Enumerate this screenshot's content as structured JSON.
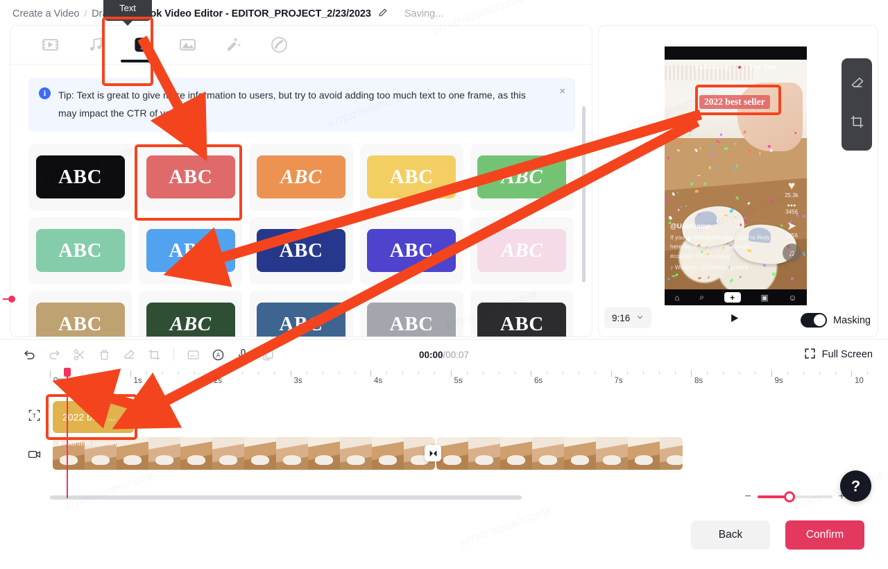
{
  "breadcrumb": {
    "root": "Create a Video",
    "sep": "/",
    "drafts": "Drafts",
    "current": "TikTok Video Editor - EDITOR_PROJECT_2/23/2023",
    "edit_icon": "pencil-icon",
    "status": "Saving..."
  },
  "toolbar": {
    "tabs": [
      {
        "name": "video",
        "icon": "film-icon",
        "active": false
      },
      {
        "name": "music",
        "icon": "music-note-icon",
        "active": false
      },
      {
        "name": "text",
        "icon": "text-t-icon",
        "active": true
      },
      {
        "name": "transition",
        "icon": "transition-icon",
        "active": false
      },
      {
        "name": "effects",
        "icon": "magic-wand-icon",
        "active": false
      },
      {
        "name": "sticker",
        "icon": "sticker-icon",
        "active": false
      }
    ],
    "tooltip": "Text"
  },
  "tip": {
    "icon": "info-icon",
    "text": "Tip: Text is great to give more information to users, but try to avoid adding too much text to one frame, as this may impact the CTR of your ad.",
    "close": "×"
  },
  "styles": {
    "label": "ABC",
    "items": [
      {
        "bg": "#0d0d0f",
        "fg": "#ffffff",
        "italic": false,
        "selected": false
      },
      {
        "bg": "#e06a6a",
        "fg": "#ffffff",
        "italic": false,
        "selected": true
      },
      {
        "bg": "#ec9352",
        "fg": "#ffffff",
        "italic": true,
        "selected": false
      },
      {
        "bg": "#f3cf63",
        "fg": "#ffffff",
        "italic": false,
        "selected": false
      },
      {
        "bg": "#74c374",
        "fg": "#ffffff",
        "italic": true,
        "selected": false
      },
      {
        "bg": "#85ccaa",
        "fg": "#ffffff",
        "italic": false,
        "selected": false
      },
      {
        "bg": "#52a3ef",
        "fg": "#ffffff",
        "italic": false,
        "selected": false
      },
      {
        "bg": "#26388b",
        "fg": "#ffffff",
        "italic": false,
        "selected": false
      },
      {
        "bg": "#4d43cc",
        "fg": "#ffffff",
        "italic": false,
        "selected": false
      },
      {
        "bg": "#f5dbe8",
        "fg": "#ffffff",
        "italic": true,
        "selected": false
      },
      {
        "bg": "#bfa271",
        "fg": "#ffffff",
        "italic": false,
        "selected": false
      },
      {
        "bg": "#2f4f34",
        "fg": "#ffffff",
        "italic": true,
        "selected": false
      },
      {
        "bg": "#3e6590",
        "fg": "#ffffff",
        "italic": false,
        "selected": false
      },
      {
        "bg": "#a3a7ad",
        "fg": "#ffffff",
        "italic": false,
        "selected": false
      },
      {
        "bg": "#2c2c2e",
        "fg": "#ffffff",
        "italic": false,
        "selected": false
      }
    ]
  },
  "preview": {
    "tiktok_feed": {
      "following": "Following",
      "for_you": "For You"
    },
    "overlay_text": "2022 best seller",
    "rail": [
      {
        "icon": "heart-icon",
        "glyph": "♥",
        "count": "25.3k"
      },
      {
        "icon": "comment-icon",
        "glyph": "●●●",
        "count": "3456"
      },
      {
        "icon": "share-icon",
        "glyph": "➤",
        "count": "1256"
      },
      {
        "icon": "music-disc-icon",
        "glyph": "♫",
        "count": ""
      }
    ],
    "caption": {
      "username": "@Username",
      "body": "If you're visiting this page, you're likely here because you're searching. #cosplay #21 #cosplay",
      "music": "♪  Woohoo - Christina Aguilera"
    },
    "nav": [
      {
        "name": "home",
        "glyph": "⌂"
      },
      {
        "name": "search",
        "glyph": "⌕"
      },
      {
        "name": "create",
        "glyph": "+"
      },
      {
        "name": "inbox",
        "glyph": "▣"
      },
      {
        "name": "profile",
        "glyph": "☺"
      }
    ],
    "side_tools": [
      {
        "name": "eraser-icon"
      },
      {
        "name": "crop-icon"
      }
    ],
    "ratio": "9:16",
    "ratio_caret": "chevron-down-icon",
    "play": "play-icon",
    "masking_label": "Masking",
    "masking_on": true
  },
  "timeline": {
    "tools": [
      {
        "name": "undo",
        "icon": "undo-icon",
        "dim": false
      },
      {
        "name": "redo",
        "icon": "redo-icon",
        "dim": true
      },
      {
        "name": "split",
        "icon": "scissors-icon",
        "dim": true
      },
      {
        "name": "delete",
        "icon": "trash-icon",
        "dim": true
      },
      {
        "name": "eraser",
        "icon": "eraser-icon",
        "dim": true
      },
      {
        "name": "crop",
        "icon": "crop-icon",
        "dim": true
      },
      {
        "name": "caption",
        "icon": "caption-icon",
        "dim": true
      },
      {
        "name": "auto-caption",
        "icon": "auto-caption-icon",
        "dim": false
      },
      {
        "name": "voiceover",
        "icon": "microphone-icon",
        "dim": false
      },
      {
        "name": "duplicate",
        "icon": "copy-icon",
        "dim": true
      }
    ],
    "current_time": "00:00",
    "total_time": "/00:07",
    "full_screen": "Full Screen",
    "full_screen_icon": "expand-icon",
    "ruler_labels": [
      "0ms",
      "1s",
      "2s",
      "3s",
      "4s",
      "5s",
      "6s",
      "7s",
      "8s",
      "9s",
      "10"
    ],
    "text_track_icon": "text-track-icon",
    "video_track_icon": "video-track-icon",
    "text_clip_label": "2022 best ...",
    "video_clip_label": "Confetti cannon",
    "transition_icon": "transition-marker-icon",
    "zoom_minus": "−",
    "zoom_plus": "+",
    "help": "?"
  },
  "footer": {
    "back": "Back",
    "confirm": "Confirm"
  },
  "watermark": "6778327620050732038"
}
